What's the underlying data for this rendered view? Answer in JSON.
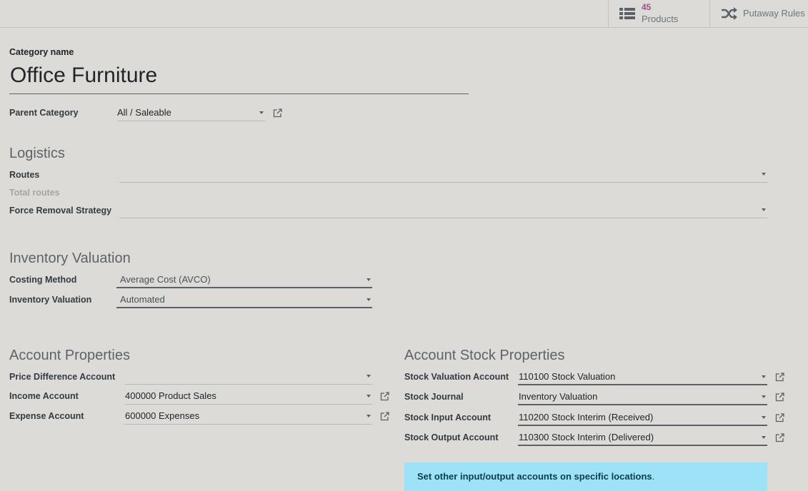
{
  "smart_buttons": {
    "products": {
      "count": "45",
      "label": "Products",
      "icon": "list-icon"
    },
    "putaway": {
      "label": "Putaway Rules",
      "icon": "shuffle-icon"
    }
  },
  "category": {
    "name_label": "Category name",
    "name": "Office Furniture",
    "parent_label": "Parent Category",
    "parent_value": "All / Saleable"
  },
  "logistics": {
    "title": "Logistics",
    "routes_label": "Routes",
    "routes_value": "",
    "total_routes_label": "Total routes",
    "removal_label": "Force Removal Strategy",
    "removal_value": ""
  },
  "valuation": {
    "title": "Inventory Valuation",
    "costing_label": "Costing Method",
    "costing_value": "Average Cost (AVCO)",
    "valuation_label": "Inventory Valuation",
    "valuation_value": "Automated"
  },
  "account_properties": {
    "title": "Account Properties",
    "price_diff_label": "Price Difference Account",
    "price_diff_value": "",
    "income_label": "Income Account",
    "income_value": "400000 Product Sales",
    "expense_label": "Expense Account",
    "expense_value": "600000 Expenses"
  },
  "stock_properties": {
    "title": "Account Stock Properties",
    "valuation_account_label": "Stock Valuation Account",
    "valuation_account_value": "110100 Stock Valuation",
    "journal_label": "Stock Journal",
    "journal_value": "Inventory Valuation",
    "input_label": "Stock Input Account",
    "input_value": "110200 Stock Interim (Received)",
    "output_label": "Stock Output Account",
    "output_value": "110300 Stock Interim (Delivered)"
  },
  "notice": {
    "link_text": "Set other input/output accounts on specific locations",
    "suffix": "."
  },
  "colors": {
    "background": "#dcdbd8",
    "accent": "#9a4f8c",
    "notice_bg": "#9ee2f7"
  }
}
